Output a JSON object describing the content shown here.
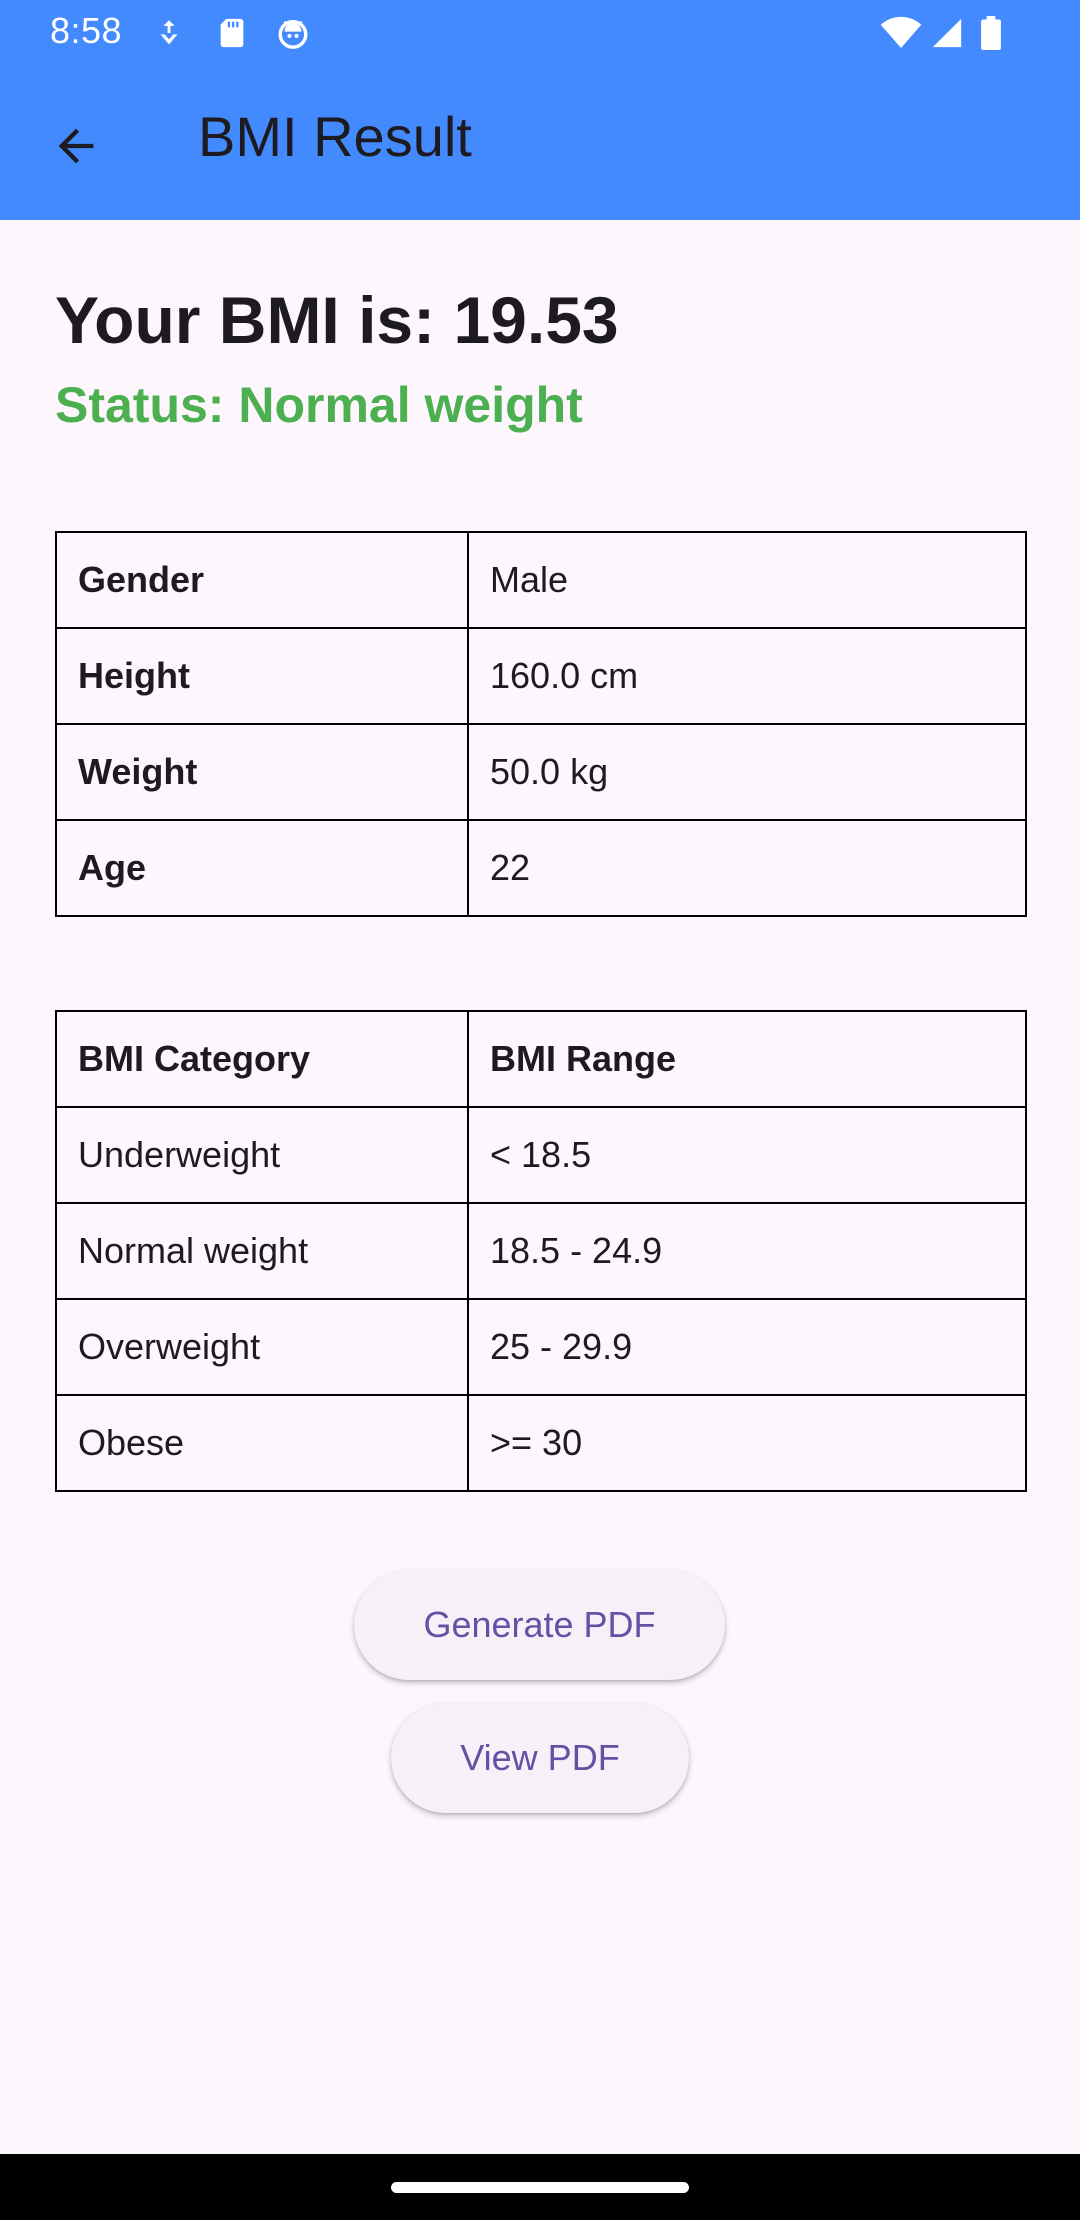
{
  "status_bar": {
    "time": "8:58",
    "left_icons": [
      "download-icon",
      "sd-card-icon",
      "android-face-icon"
    ],
    "right_icons": [
      "wifi-icon",
      "signal-icon",
      "battery-icon"
    ]
  },
  "app_bar": {
    "title": "BMI Result",
    "back_icon": "arrow-back-icon",
    "color": "#448aff"
  },
  "result": {
    "headline": "Your BMI is: 19.53",
    "status": "Status: Normal weight",
    "status_color": "#4caf50"
  },
  "info_table": [
    {
      "label": "Gender",
      "value": "Male"
    },
    {
      "label": "Height",
      "value": "160.0 cm"
    },
    {
      "label": "Weight",
      "value": "50.0 kg"
    },
    {
      "label": "Age",
      "value": "22"
    }
  ],
  "category_table": {
    "headers": [
      "BMI Category",
      "BMI Range"
    ],
    "rows": [
      {
        "category": "Underweight",
        "range": "< 18.5"
      },
      {
        "category": "Normal weight",
        "range": "18.5 - 24.9"
      },
      {
        "category": "Overweight",
        "range": "25 - 29.9"
      },
      {
        "category": "Obese",
        "range": ">= 30"
      }
    ]
  },
  "buttons": {
    "generate_pdf": "Generate PDF",
    "view_pdf": "View PDF",
    "text_color": "#6750a4"
  }
}
